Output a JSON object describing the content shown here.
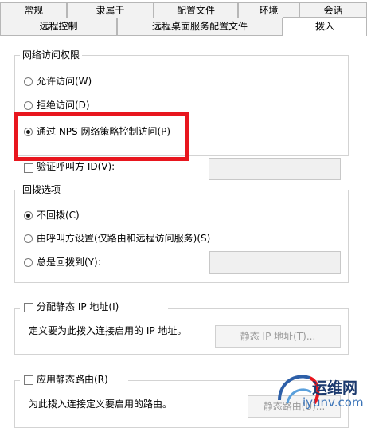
{
  "tabs_top": [
    "常规",
    "隶属于",
    "配置文件",
    "环境",
    "会话"
  ],
  "tabs_bottom": [
    "远程控制",
    "远程桌面服务配置文件",
    "拨入"
  ],
  "network_access": {
    "title": "网络访问权限",
    "options": [
      "允许访问(W)",
      "拒绝访问(D)",
      "通过 NPS 网络策略控制访问(P)"
    ],
    "selected_index": 2
  },
  "verify_caller_id": {
    "label": "验证呼叫方 ID(V):",
    "checked": false,
    "value": ""
  },
  "callback": {
    "title": "回拨选项",
    "options": [
      "不回拨(C)",
      "由呼叫方设置(仅路由和远程访问服务)(S)",
      "总是回拨到(Y):"
    ],
    "selected_index": 0,
    "always_value": ""
  },
  "static_ip": {
    "label": "分配静态 IP 地址(I)",
    "checked": false,
    "description": "定义要为此拨入连接启用的 IP 地址。",
    "button": "静态 IP 地址(T)..."
  },
  "static_routes": {
    "label": "应用静态路由(R)",
    "checked": false,
    "description": "为此拨入连接定义要启用的路由。",
    "button": "静态路由(U)..."
  },
  "watermark": {
    "cn": "运维网",
    "en": "iyunv.com"
  },
  "colors": {
    "highlight": "#e8161e",
    "disabled_text": "#9a9a9a",
    "border": "#d3d3d3"
  }
}
